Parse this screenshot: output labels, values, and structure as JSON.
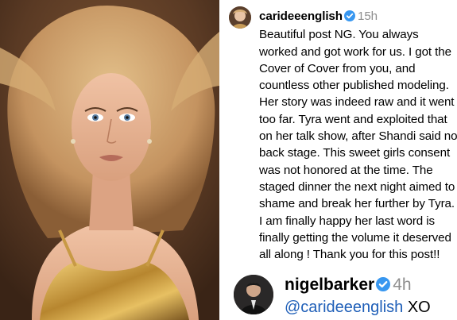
{
  "post_image": {
    "subject": "model-portrait",
    "colors": {
      "background": "#5a3a24",
      "hair": "#c9a06a",
      "skin": "#e8b496",
      "dress": "#c79a45"
    }
  },
  "comments": [
    {
      "username": "carideeenglish",
      "verified": true,
      "time": "15h",
      "text": "Beautiful post NG. You always worked and got work for us. I got the Cover of Cover from you, and countless other published modeling. Her story was indeed raw and it went too far. Tyra went and exploited that on her talk show, after Shandi said no back stage. This sweet girls consent was not honored at the time. The staged dinner the next night aimed to shame and break her further by Tyra. I am finally happy her last word is finally getting the volume it deserved all along ! Thank you for this post!!"
    },
    {
      "username": "nigelbarker",
      "verified": true,
      "time": "4h",
      "mention": "@carideeenglish",
      "text": " XO"
    }
  ],
  "colors": {
    "verified_badge": "#3897f0",
    "mention": "#1f5fb8",
    "timestamp": "#8e8e8e"
  }
}
